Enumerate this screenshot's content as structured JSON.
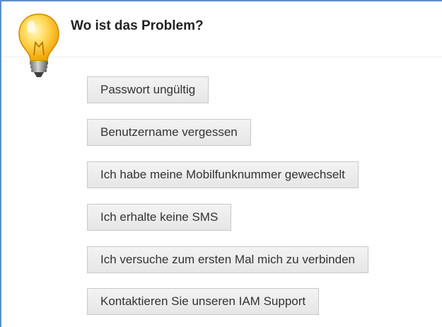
{
  "header": {
    "title": "Wo ist das Problem?",
    "icon": "lightbulb-icon",
    "border_color": "#5b8fc7"
  },
  "options": [
    {
      "label": "Passwort ungültig"
    },
    {
      "label": "Benutzername vergessen"
    },
    {
      "label": "Ich habe meine Mobilfunknummer gewechselt"
    },
    {
      "label": "Ich erhalte keine SMS"
    },
    {
      "label": "Ich versuche zum ersten Mal mich zu verbinden"
    },
    {
      "label": "Kontaktieren Sie unseren IAM Support"
    }
  ]
}
